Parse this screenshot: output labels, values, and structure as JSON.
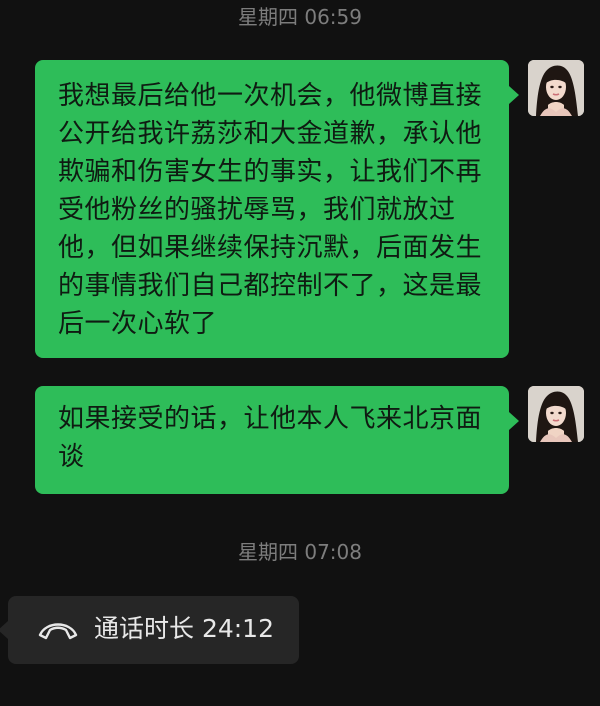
{
  "chat": {
    "timestamps": [
      {
        "label": "星期四 06:59"
      },
      {
        "label": "星期四 07:08"
      }
    ],
    "messages": [
      {
        "text": "我想最后给他一次机会，他微博直接公开给我许荔莎和大金道歉，承认他欺骗和伤害女生的事实，让我们不再受他粉丝的骚扰辱骂，我们就放过他，但如果继续保持沉默，后面发生的事情我们自己都控制不了，这是最后一次心软了",
        "sender_avatar": "avatar-female"
      },
      {
        "text": "如果接受的话，让他本人飞来北京面谈",
        "sender_avatar": "avatar-female"
      }
    ],
    "call": {
      "label": "通话时长 24:12",
      "icon": "phone-hangup-icon"
    }
  },
  "colors": {
    "background": "#111111",
    "bubble": "#2ebd59",
    "call_card": "#262626",
    "timestamp": "#7d7d7d"
  }
}
